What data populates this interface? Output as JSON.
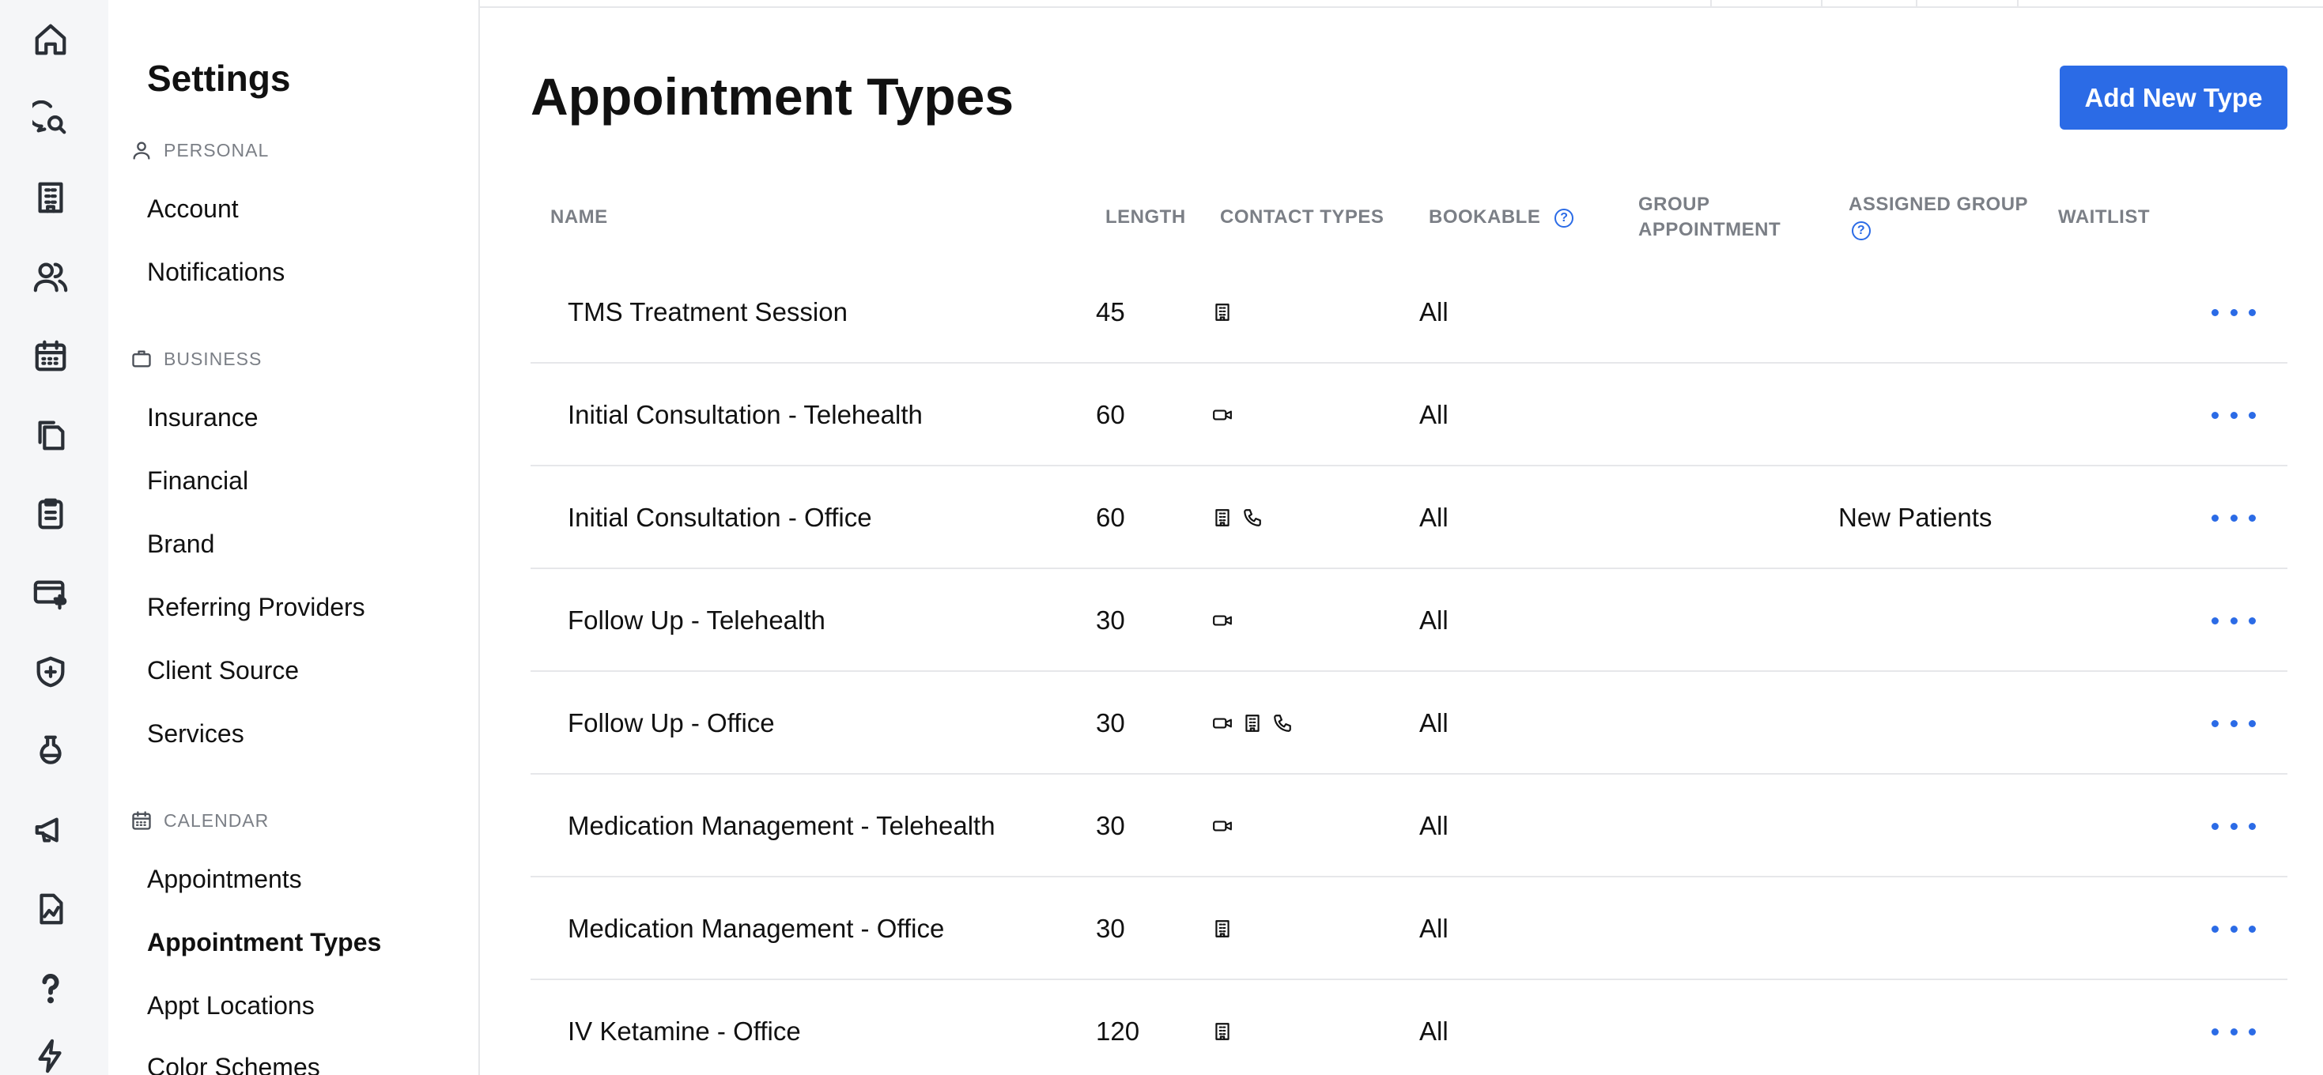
{
  "rail": {
    "icons": [
      "home-icon",
      "chat-search-icon",
      "building-icon",
      "users-icon",
      "calendar-icon",
      "documents-icon",
      "clipboard-icon",
      "billing-icon",
      "shield-icon",
      "lab-flask-icon",
      "megaphone-icon",
      "chart-document-icon",
      "help-icon",
      "bolt-icon"
    ]
  },
  "settings": {
    "title": "Settings",
    "sections": {
      "personal": {
        "label": "PERSONAL",
        "items": [
          "Account",
          "Notifications"
        ]
      },
      "business": {
        "label": "BUSINESS",
        "items": [
          "Insurance",
          "Financial",
          "Brand",
          "Referring Providers",
          "Client Source",
          "Services"
        ]
      },
      "calendar": {
        "label": "CALENDAR",
        "items": [
          "Appointments",
          "Appointment Types",
          "Appt Locations",
          "Color Schemes"
        ]
      }
    },
    "active_item": "Appointment Types"
  },
  "main": {
    "title": "Appointment Types",
    "add_button": "Add New Type",
    "columns": {
      "name": "NAME",
      "length": "LENGTH",
      "contact_types": "CONTACT TYPES",
      "bookable": "BOOKABLE",
      "group_appointment_1": "GROUP",
      "group_appointment_2": "APPOINTMENT",
      "assigned_group": "ASSIGNED GROUP",
      "waitlist": "WAITLIST",
      "help_glyph": "?"
    },
    "rows": [
      {
        "name": "TMS Treatment Session",
        "length": "45",
        "contact": [
          "office-icon"
        ],
        "bookable": "All",
        "group": ""
      },
      {
        "name": "Initial Consultation - Telehealth",
        "length": "60",
        "contact": [
          "video-icon"
        ],
        "bookable": "All",
        "group": ""
      },
      {
        "name": "Initial Consultation - Office",
        "length": "60",
        "contact": [
          "office-icon",
          "phone-icon"
        ],
        "bookable": "All",
        "group": "New Patients"
      },
      {
        "name": "Follow Up - Telehealth",
        "length": "30",
        "contact": [
          "video-icon"
        ],
        "bookable": "All",
        "group": ""
      },
      {
        "name": "Follow Up - Office",
        "length": "30",
        "contact": [
          "video-icon",
          "office-icon",
          "phone-icon"
        ],
        "bookable": "All",
        "group": ""
      },
      {
        "name": "Medication Management - Telehealth",
        "length": "30",
        "contact": [
          "video-icon"
        ],
        "bookable": "All",
        "group": ""
      },
      {
        "name": "Medication Management - Office",
        "length": "30",
        "contact": [
          "office-icon"
        ],
        "bookable": "All",
        "group": ""
      },
      {
        "name": "IV Ketamine - Office",
        "length": "120",
        "contact": [
          "office-icon"
        ],
        "bookable": "All",
        "group": ""
      }
    ]
  },
  "colors": {
    "accent": "#2b6be6",
    "muted_text": "#7b7f86",
    "divider": "#e6e7ea",
    "rail_bg": "#f5f6f8"
  }
}
